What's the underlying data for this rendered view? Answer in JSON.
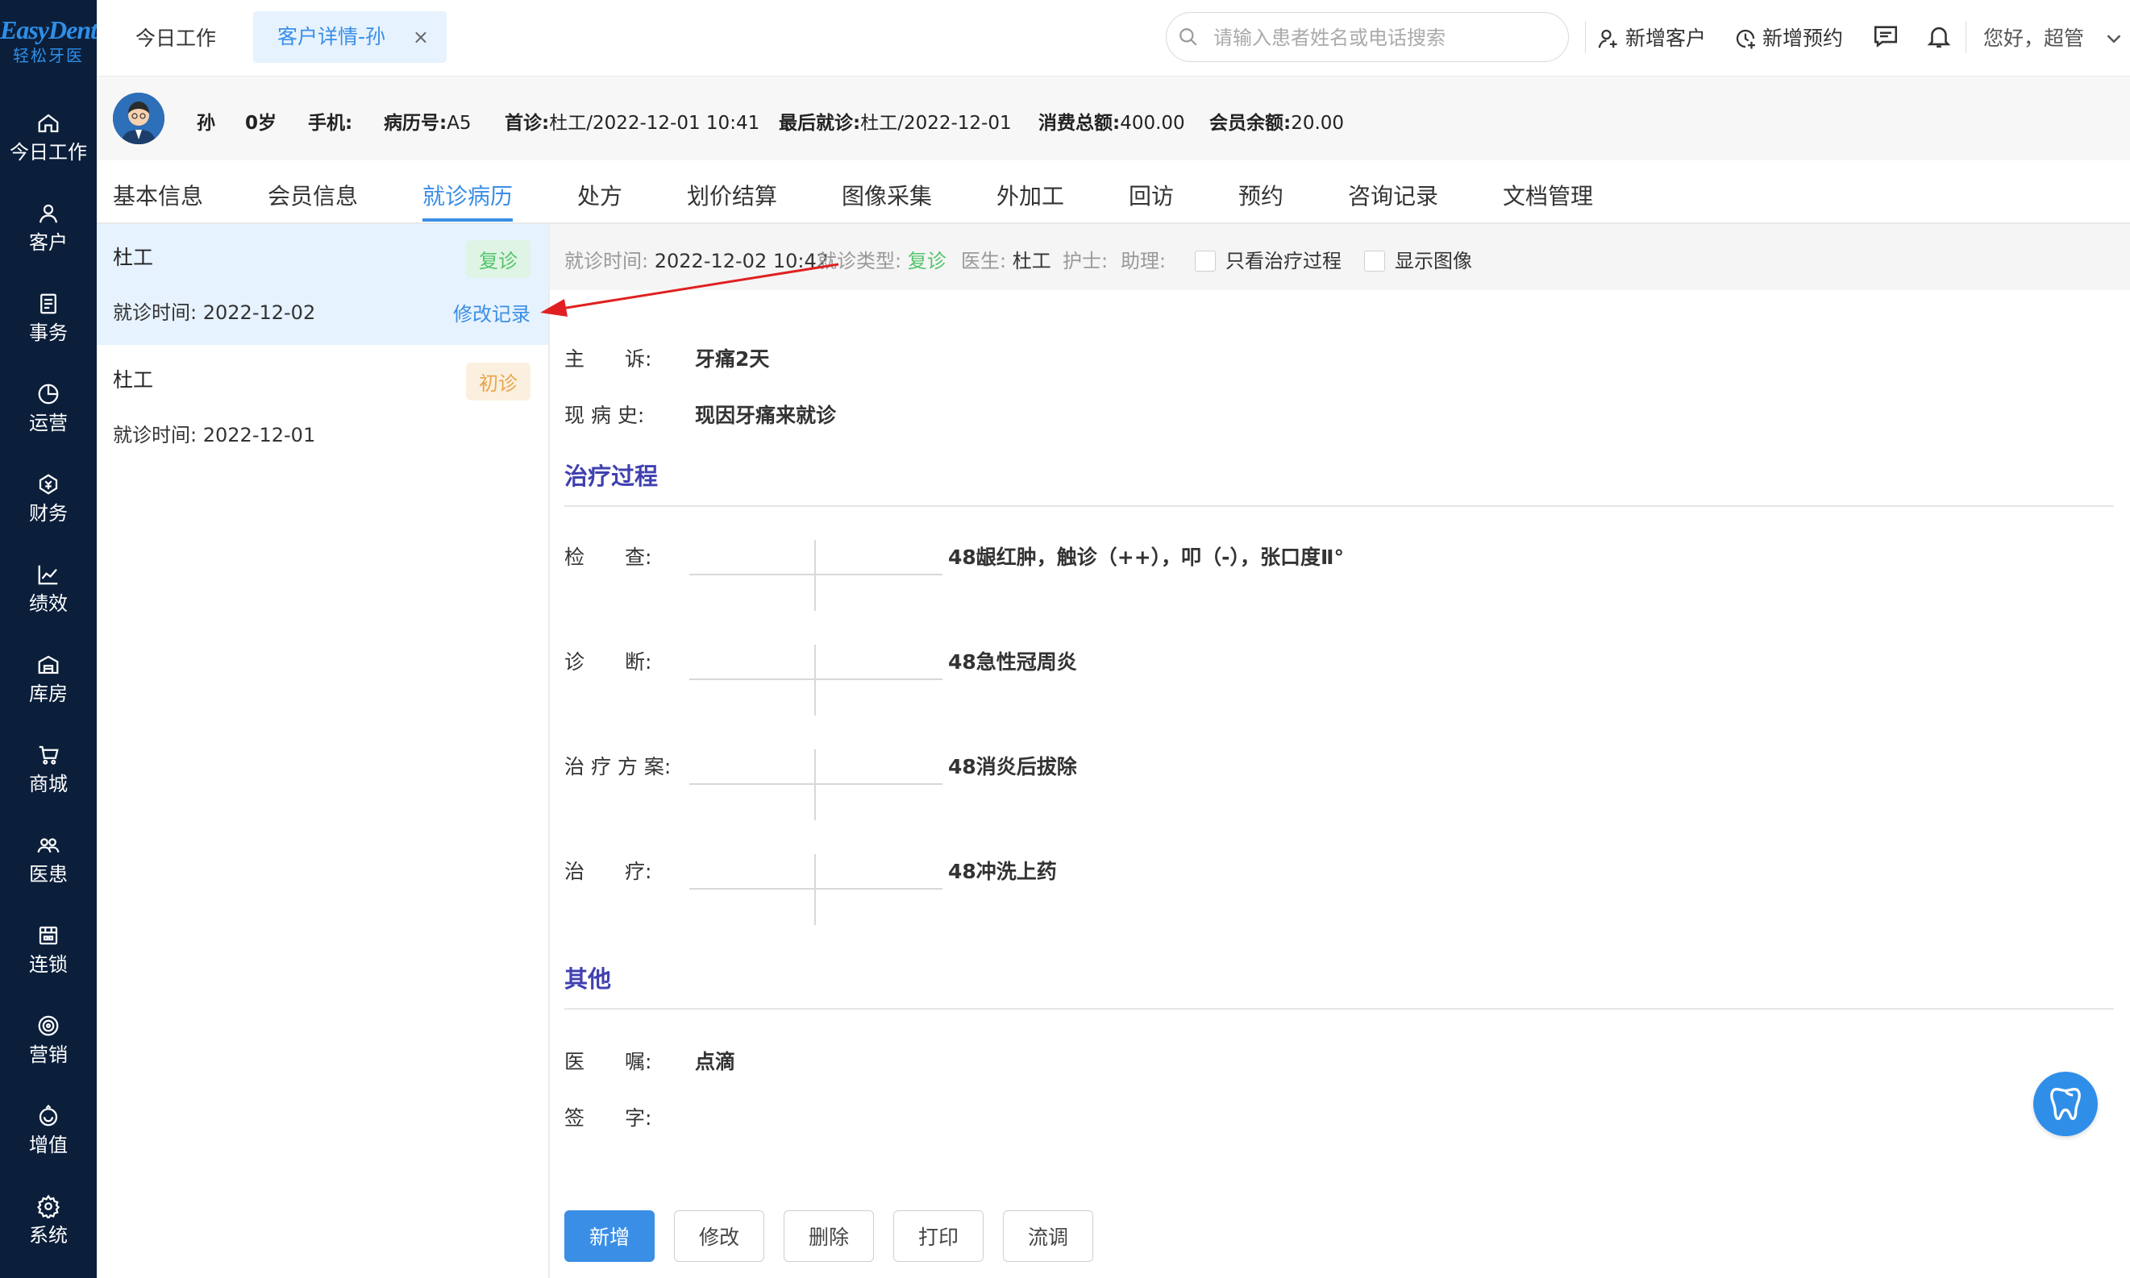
{
  "colors": {
    "sidebar_bg": "#0b1f3b",
    "accent": "#3a8ee6",
    "revisit_green": "#52c46b",
    "first_orange": "#eaa54a",
    "section_title": "#4040b0",
    "annotation_arrow": "#e02020"
  },
  "logo": {
    "title": "EasyDent",
    "subtitle": "轻松牙医"
  },
  "sidebar": {
    "items": [
      {
        "label": "今日工作",
        "icon": "home-icon"
      },
      {
        "label": "客户",
        "icon": "user-icon"
      },
      {
        "label": "事务",
        "icon": "document-icon"
      },
      {
        "label": "运营",
        "icon": "pie-chart-icon"
      },
      {
        "label": "财务",
        "icon": "money-icon"
      },
      {
        "label": "绩效",
        "icon": "line-chart-icon"
      },
      {
        "label": "库房",
        "icon": "warehouse-icon"
      },
      {
        "label": "商城",
        "icon": "cart-icon"
      },
      {
        "label": "医患",
        "icon": "people-icon"
      },
      {
        "label": "连锁",
        "icon": "store-icon"
      },
      {
        "label": "营销",
        "icon": "target-icon"
      },
      {
        "label": "增值",
        "icon": "value-icon"
      },
      {
        "label": "系统",
        "icon": "gear-icon"
      }
    ]
  },
  "topbar": {
    "tabs": [
      {
        "label": "今日工作"
      },
      {
        "label": "客户详情-孙",
        "close": "×"
      }
    ],
    "search": {
      "placeholder": "请输入患者姓名或电话搜索"
    },
    "add_customer": "新增客户",
    "add_appointment": "新增预约",
    "greeting": "您好，超管"
  },
  "patient": {
    "name": "孙",
    "age": "0岁",
    "phone_label": "手机:",
    "record_no_label": "病历号:",
    "record_no": "A5",
    "first_visit_label": "首诊:",
    "first_visit": "杜工/2022-12-01 10:41",
    "last_visit_label": "最后就诊:",
    "last_visit": "杜工/2022-12-01",
    "total_spend_label": "消费总额:",
    "total_spend": "400.00",
    "member_balance_label": "会员余额:",
    "member_balance": "20.00"
  },
  "subtabs": [
    "基本信息",
    "会员信息",
    "就诊病历",
    "处方",
    "划价结算",
    "图像采集",
    "外加工",
    "回访",
    "预约",
    "咨询记录",
    "文档管理"
  ],
  "visits": [
    {
      "doctor": "杜工",
      "type": "复诊",
      "time_label": "就诊时间:",
      "time": "2022-12-02",
      "edit": "修改记录"
    },
    {
      "doctor": "杜工",
      "type": "初诊",
      "time_label": "就诊时间:",
      "time": "2022-12-01"
    }
  ],
  "record": {
    "header": {
      "time_label": "就诊时间:",
      "time": "2022-12-02 10:42",
      "type_label": "就诊类型:",
      "type": "复诊",
      "doctor_label": "医生:",
      "doctor": "杜工",
      "nurse_label": "护士:",
      "assistant_label": "助理:",
      "only_process": "只看治疗过程",
      "show_images": "显示图像"
    },
    "chief_complaint_label": "主　　诉:",
    "chief_complaint": "牙痛2天",
    "present_illness_label": "现 病 史:",
    "present_illness": "现因牙痛来就诊",
    "process_title": "治疗过程",
    "exam_label": "检　　查:",
    "exam": "48龈红肿，触诊（++），叩（-），张口度Ⅱ°",
    "diagnosis_label": "诊　　断:",
    "diagnosis": "48急性冠周炎",
    "plan_label": "治 疗 方 案:",
    "plan": "48消炎后拔除",
    "treatment_label": "治　　疗:",
    "treatment": "48冲洗上药",
    "other_title": "其他",
    "advice_label": "医　　嘱:",
    "advice": "点滴",
    "signature_label": "签　　字:"
  },
  "buttons": {
    "add": "新增",
    "modify": "修改",
    "delete": "删除",
    "print": "打印",
    "transfer": "流调"
  }
}
